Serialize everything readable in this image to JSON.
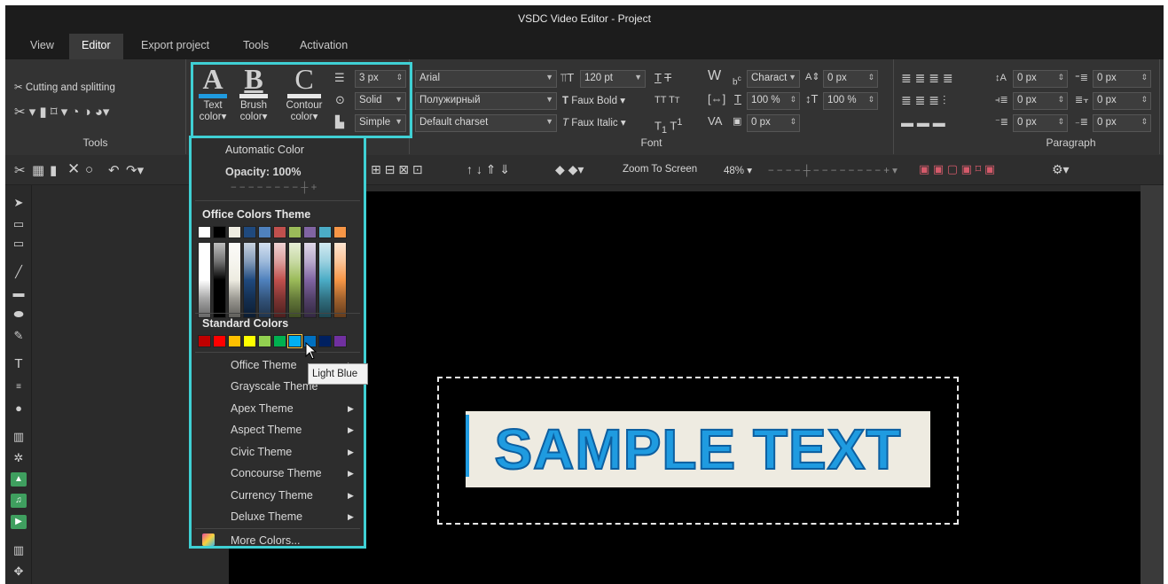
{
  "title": "VSDC Video Editor - Project",
  "menu": [
    "View",
    "Editor",
    "Export project",
    "Tools",
    "Activation"
  ],
  "ribbon": {
    "tools": {
      "cutting_label": "Cutting and splitting",
      "group_label": "Tools"
    },
    "text_color_label": "Text color▾",
    "brush_color_label": "Brush color▾",
    "contour_color_label": "Contour color▾",
    "line_width": "3 px",
    "line_style": "Solid",
    "line_type": "Simple",
    "font": {
      "name": "Arial",
      "style": "Полужирный",
      "charset": "Default charset",
      "size": "120 pt",
      "faux_bold": "Faux Bold",
      "faux_italic": "Faux Italic",
      "char_spacing_mode": "Charact",
      "char_spacing": "0 px",
      "scale_h": "100 %",
      "scale_v": "100 %",
      "offset": "0 px",
      "group_label": "Font"
    },
    "paragraph": {
      "values": [
        "0 px",
        "0 px",
        "0 px",
        "0 px",
        "0 px",
        "0 px"
      ],
      "group_label": "Paragraph"
    }
  },
  "toolbar2": {
    "zoom_label": "Zoom To Screen",
    "zoom_value": "48%"
  },
  "dropdown": {
    "automatic_color": "Automatic Color",
    "opacity": "Opacity: 100%",
    "office_colors_header": "Office Colors Theme",
    "office_colors_top": [
      "#ffffff",
      "#000000",
      "#eeece1",
      "#1f497d",
      "#4f81bd",
      "#c0504d",
      "#9bbb59",
      "#8064a2",
      "#4bacc6",
      "#f79646"
    ],
    "standard_colors_header": "Standard Colors",
    "standard_colors": [
      "#c00000",
      "#ff0000",
      "#ffc000",
      "#ffff00",
      "#92d050",
      "#00b050",
      "#00b0f0",
      "#0070c0",
      "#002060",
      "#7030a0"
    ],
    "themes": [
      "Office Theme",
      "Grayscale Theme",
      "Apex Theme",
      "Aspect Theme",
      "Civic Theme",
      "Concourse Theme",
      "Currency Theme",
      "Deluxe Theme"
    ],
    "more_colors": "More Colors...",
    "tooltip": "Light Blue"
  },
  "canvas": {
    "sample_text": "SAMPLE TEXT",
    "text_color": "#1f9be0"
  }
}
